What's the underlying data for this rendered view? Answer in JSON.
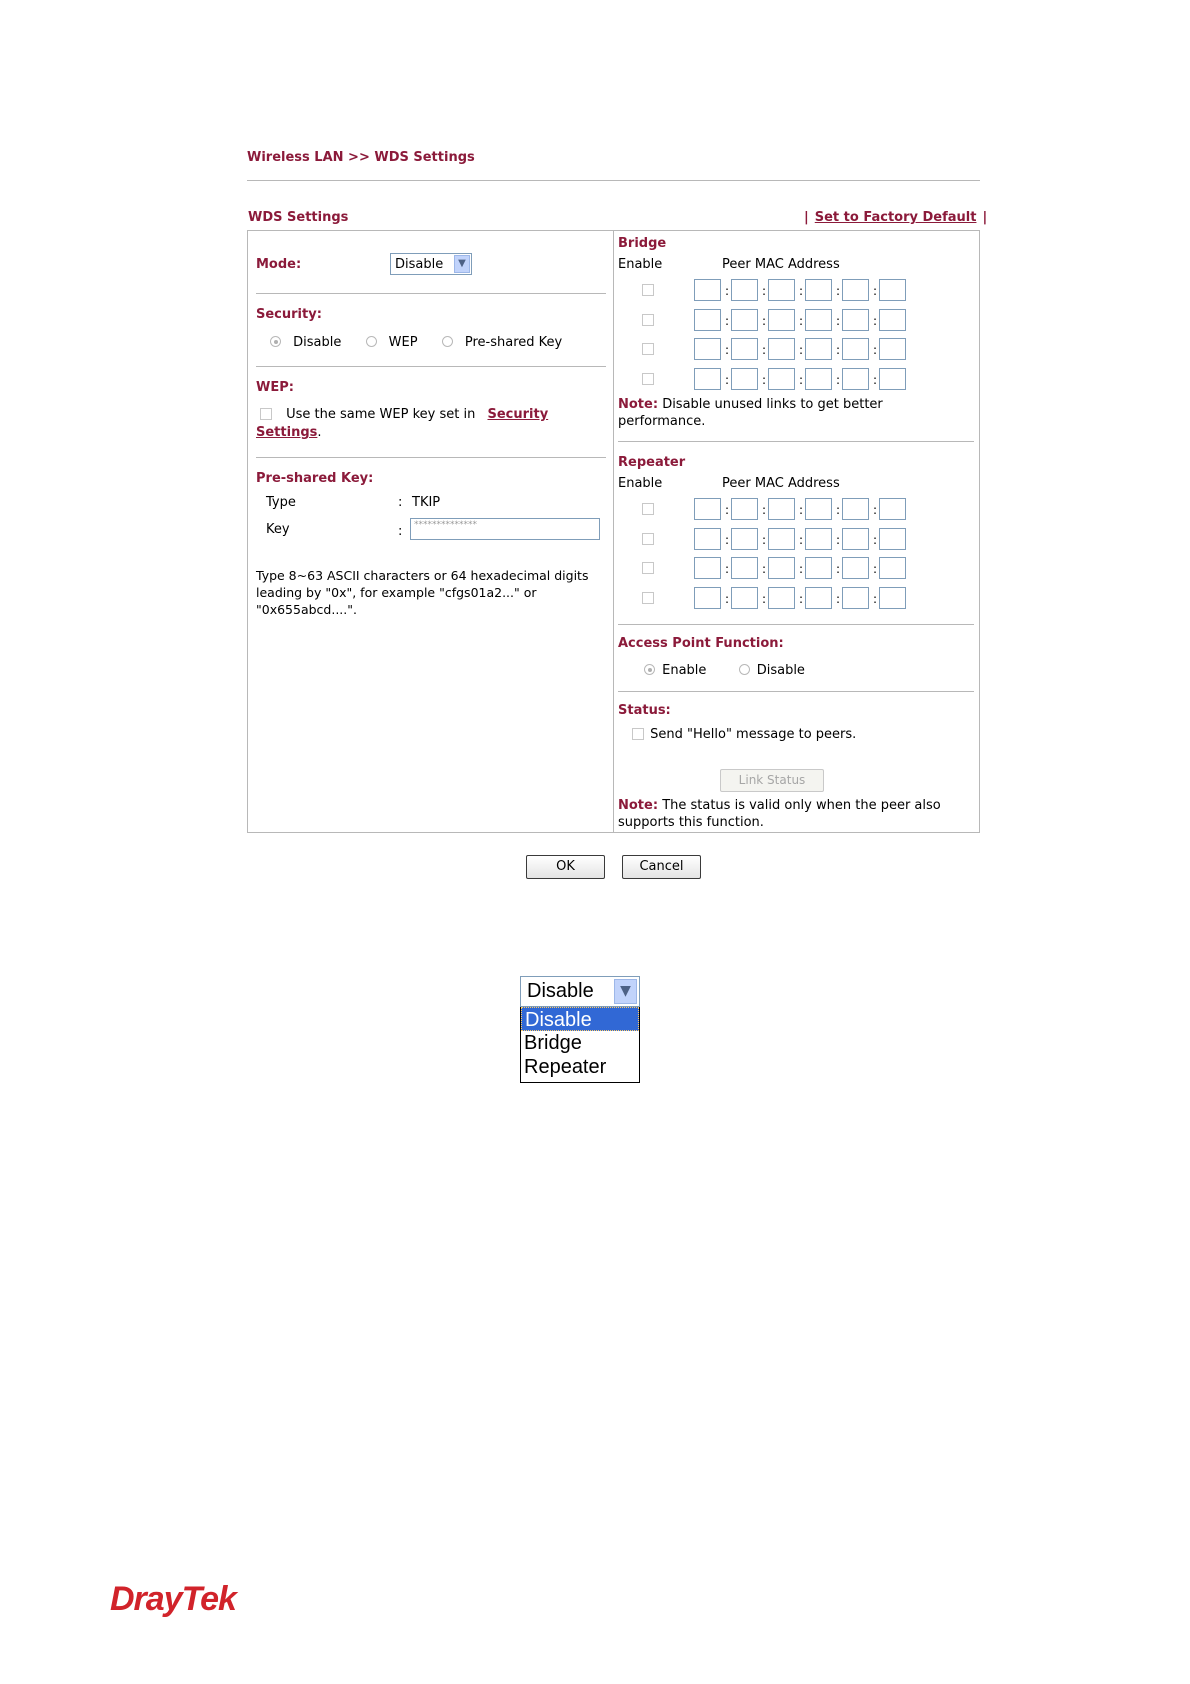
{
  "breadcrumb": "Wireless LAN >> WDS Settings",
  "section_title": "WDS Settings",
  "factory_default": {
    "sep": "|",
    "label": "Set to Factory Default"
  },
  "left": {
    "mode_label": "Mode:",
    "mode_value": "Disable",
    "security_label": "Security:",
    "security_options": [
      "Disable",
      "WEP",
      "Pre-shared Key"
    ],
    "security_selected": "Disable",
    "wep_label": "WEP:",
    "wep_text": "Use the same WEP key set in",
    "wep_link_1": "Security",
    "wep_link_2": "Settings",
    "wep_period": ".",
    "psk_label": "Pre-shared Key:",
    "type_label": "Type",
    "type_sep": ":",
    "type_value": "TKIP",
    "key_label": "Key",
    "key_sep": ":",
    "key_value": "**************",
    "psk_note": "Type 8~63 ASCII characters or 64 hexadecimal digits leading by \"0x\", for example \"cfgs01a2...\" or \"0x655abcd....\"."
  },
  "right": {
    "bridge_label": "Bridge",
    "enable_col": "Enable",
    "peer_mac_col": "Peer MAC Address",
    "bridge_note_label": "Note:",
    "bridge_note": "Disable unused links to get better performance.",
    "repeater_label": "Repeater",
    "ap_function_label": "Access Point Function:",
    "ap_options": [
      "Enable",
      "Disable"
    ],
    "ap_selected": "Enable",
    "status_label": "Status:",
    "hello_text": "Send \"Hello\" message to peers.",
    "link_status": "Link Status",
    "status_note_label": "Note:",
    "status_note": "The status is valid only when the peer also supports this function."
  },
  "buttons": {
    "ok": "OK",
    "cancel": "Cancel"
  },
  "dropdown_demo": {
    "current": "Disable",
    "options": [
      "Disable",
      "Bridge",
      "Repeater"
    ],
    "highlighted": "Disable"
  },
  "logo": "DrayTek",
  "colors": {
    "accent": "#8b1a3a",
    "border": "#b8b8b8",
    "input_border": "#7f9db9",
    "logo": "#d1232a",
    "highlight": "#3168d5"
  },
  "icons": {
    "dropdown_arrow": "chevron-down-icon"
  }
}
